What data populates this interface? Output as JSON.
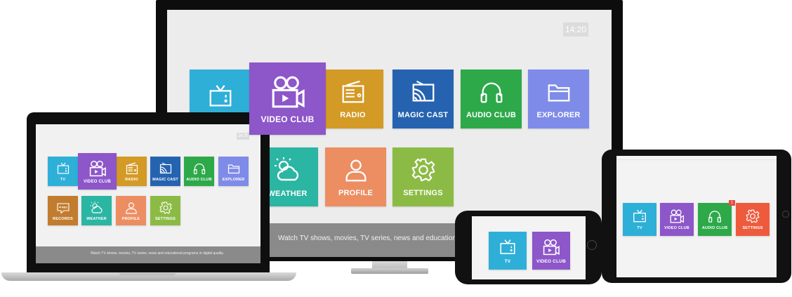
{
  "colors": {
    "tv": "#2eafd8",
    "video_club": "#8d56c9",
    "radio": "#d49a26",
    "magic_cast": "#2563b0",
    "audio_club": "#2da94a",
    "explorer": "#7f8be8",
    "weather": "#2bb5a3",
    "profile": "#ec8e62",
    "settings": "#8cbb45",
    "records": "#c17c2e",
    "settings_red": "#ee5a3c"
  },
  "tv": {
    "clock": "14:20",
    "tiles": [
      {
        "label": "",
        "icon": "tv-icon"
      },
      {
        "label": "VIDEO CLUB",
        "icon": "video-camera-icon"
      },
      {
        "label": "RADIO",
        "icon": "radio-icon"
      },
      {
        "label": "MAGIC CAST",
        "icon": "cast-icon"
      },
      {
        "label": "AUDIO CLUB",
        "icon": "headphones-icon"
      },
      {
        "label": "EXPLORER",
        "icon": "folder-icon"
      },
      {
        "label": "WEATHER",
        "icon": "weather-icon"
      },
      {
        "label": "PROFILE",
        "icon": "user-icon"
      },
      {
        "label": "SETTINGS",
        "icon": "gear-icon"
      }
    ],
    "footer": "Watch TV shows, movies, TV series, news and educational programs"
  },
  "laptop": {
    "clock": "14:20",
    "tiles": [
      {
        "label": "TV",
        "icon": "tv-icon"
      },
      {
        "label": "VIDEO CLUB",
        "icon": "video-camera-icon"
      },
      {
        "label": "RADIO",
        "icon": "radio-icon"
      },
      {
        "label": "MAGIC CAST",
        "icon": "cast-icon"
      },
      {
        "label": "AUDIO CLUB",
        "icon": "headphones-icon"
      },
      {
        "label": "EXPLORER",
        "icon": "folder-icon"
      },
      {
        "label": "RECORDS",
        "icon": "rec-icon"
      },
      {
        "label": "WEATHER",
        "icon": "weather-icon"
      },
      {
        "label": "PROFILE",
        "icon": "user-icon"
      },
      {
        "label": "SETTINGS",
        "icon": "gear-icon"
      }
    ],
    "footer": "Watch TV shows, movies, TV series, news and educational programs in digital quality."
  },
  "phone": {
    "tiles": [
      {
        "label": "TV",
        "icon": "tv-icon"
      },
      {
        "label": "VIDEO CLUB",
        "icon": "video-camera-icon"
      }
    ]
  },
  "tablet": {
    "badge": "1",
    "tiles": [
      {
        "label": "TV",
        "icon": "tv-icon"
      },
      {
        "label": "VIDEO CLUB",
        "icon": "video-camera-icon"
      },
      {
        "label": "AUDIO CLUB",
        "icon": "headphones-icon"
      },
      {
        "label": "SETTINGS",
        "icon": "gear-icon"
      }
    ]
  }
}
